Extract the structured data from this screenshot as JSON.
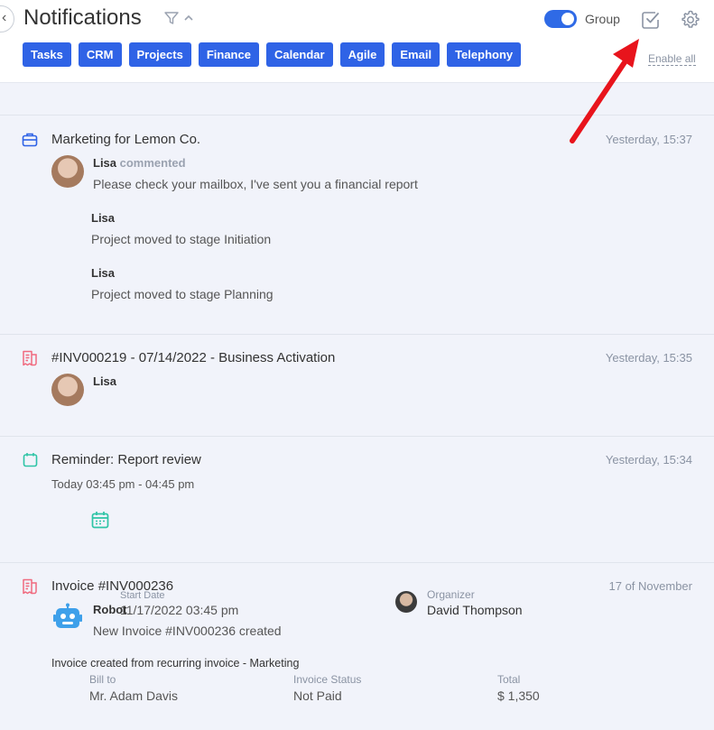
{
  "header": {
    "title": "Notifications",
    "group_label": "Group",
    "enable_all": "Enable all",
    "tabs": [
      "Tasks",
      "CRM",
      "Projects",
      "Finance",
      "Calendar",
      "Agile",
      "Email",
      "Telephony"
    ]
  },
  "colors": {
    "accent": "#2f63e6",
    "arrow": "#e8141c",
    "finance_icon": "#f06b7f",
    "calendar_icon": "#2ec4a6"
  },
  "notifications": [
    {
      "icon": "briefcase-icon",
      "title": "Marketing for Lemon Co.",
      "time": "Yesterday, 15:37",
      "comment": {
        "author": "Lisa",
        "verb": "commented",
        "text": "Please check your mailbox, I've sent you a financial report"
      },
      "events": [
        {
          "author": "Lisa",
          "text": "Project moved to stage Initiation"
        },
        {
          "author": "Lisa",
          "text": "Project moved to stage Planning"
        }
      ]
    },
    {
      "icon": "invoice-icon",
      "title": "#INV000219 - 07/14/2022 - Business Activation",
      "time": "Yesterday, 15:35",
      "author": "Lisa"
    },
    {
      "icon": "calendar-icon",
      "title": "Reminder: Report review",
      "time": "Yesterday, 15:34",
      "range": "Today 03:45 pm - 04:45 pm",
      "start_label": "Start Date",
      "start_value": "11/17/2022 03:45 pm",
      "organizer_label": "Organizer",
      "organizer_value": "David Thompson"
    },
    {
      "icon": "invoice-icon",
      "title": "Invoice #INV000236",
      "time": "17 of November",
      "author": "Robot",
      "text": "New Invoice #INV000236 created",
      "note": "Invoice created from recurring invoice - Marketing",
      "fields": [
        {
          "label": "Bill to",
          "value": "Mr. Adam Davis"
        },
        {
          "label": "Invoice Status",
          "value": "Not Paid"
        },
        {
          "label": "Total",
          "value": "$ 1,350"
        }
      ]
    }
  ]
}
